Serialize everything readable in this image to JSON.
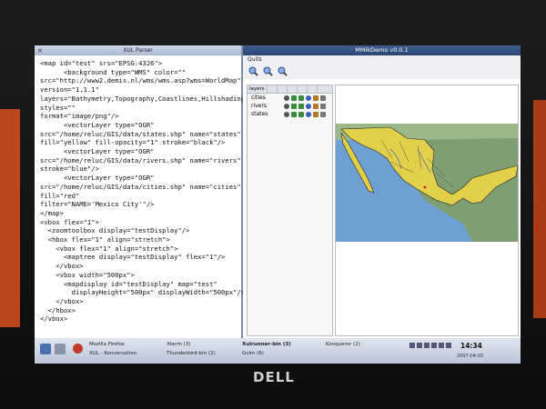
{
  "xml_window": {
    "title": "XUL Parser",
    "code_lines": [
      "<map id=\"test\" srs=\"EPSG:4326\">",
      "      <background type=\"WMS\" color=\"\"",
      "src=\"http://www2.demis.nl/wms/wms.asp?wms=WorldMap\"",
      "version=\"1.1.1\"",
      "layers=\"Bathymetry,Topography,Coastlines,Hillshading\"",
      "styles=\"\"",
      "format=\"image/png\"/>",
      "      <vectorLayer type=\"OGR\"",
      "src=\"/home/reluc/GIS/data/states.shp\" name=\"states\"",
      "fill=\"yellow\" fill-opacity=\"1\" stroke=\"black\"/>",
      "      <vectorLayer type=\"OGR\"",
      "src=\"/home/reluc/GIS/data/rivers.shp\" name=\"rivers\"",
      "stroke=\"blue\"/>",
      "      <vectorLayer type=\"OGR\"",
      "src=\"/home/reluc/GIS/data/cities.shp\" name=\"cities\"",
      "fill=\"red\"",
      "filter=\"NAME='Mexico City'\"/>",
      "</map>",
      "<vbox flex=\"1\">",
      "  <zoomtoolbox display=\"testDisplay\"/>",
      "  <hbox flex=\"1\" align=\"stretch\">",
      "    <vbox flex=\"1\" align=\"stretch\">",
      "      <maptree display=\"testDisplay\" flex=\"1\"/>",
      "    </vbox>",
      "    <vbox width=\"500px\">",
      "      <mapdisplay id=\"testDisplay\" map=\"test\"",
      "        displayHeight=\"500px\" displayWidth=\"500px\"/>",
      "    </vbox>",
      "  </hbox>",
      "</vbox>"
    ]
  },
  "map_window": {
    "title": "MMikDemo v0.0.1",
    "menu": "Quits",
    "layers_header": "layers",
    "layers": [
      "cities",
      "rivers",
      "states"
    ]
  },
  "taskbar": {
    "items": [
      "Mozilla Firefox",
      "XUL - Konversation",
      "Xterm (3)",
      "Thunderbird-bin (2)",
      "Xulrunner-bin (3)",
      "Gvim (6)",
      "Konqueror (2)"
    ],
    "clock": "14:34",
    "date": "2007-04-03"
  },
  "brand": "DELL"
}
